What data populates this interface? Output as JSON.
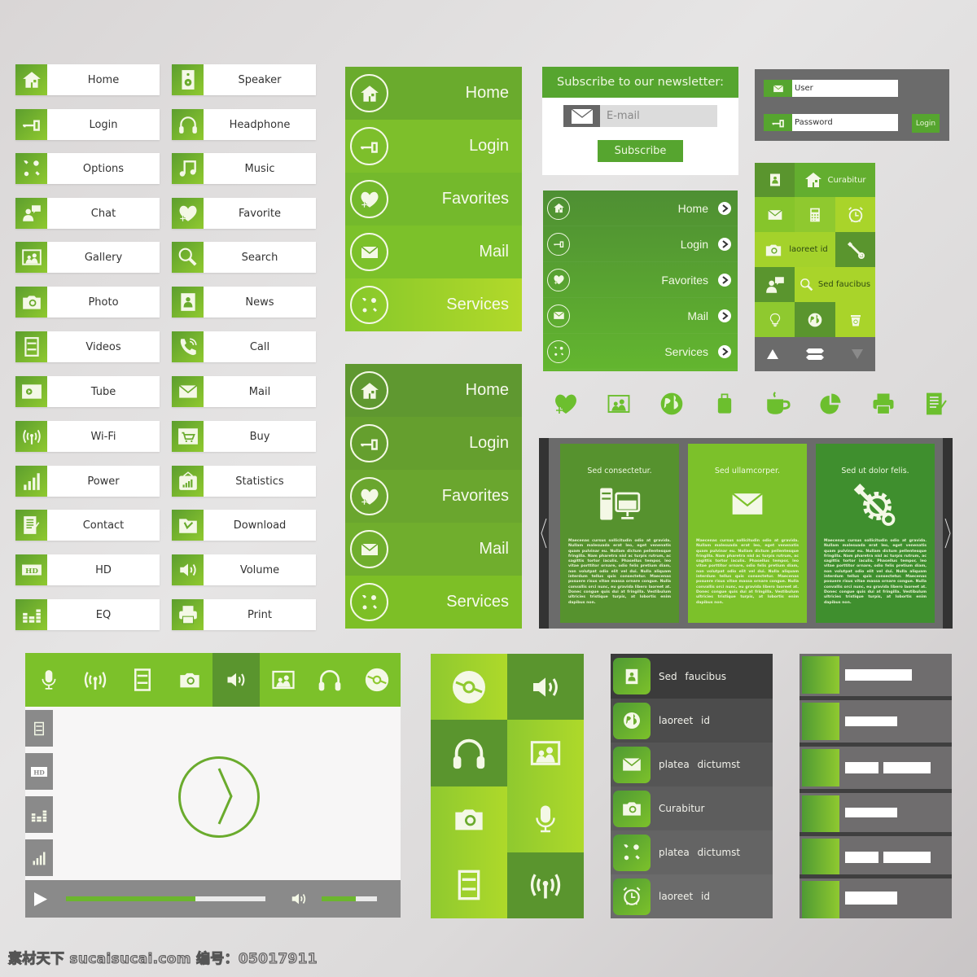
{
  "simple_buttons": {
    "left_column": [
      "Home",
      "Login",
      "Options",
      "Chat",
      "Gallery",
      "Photo",
      "Videos",
      "Tube",
      "Wi-Fi",
      "Power",
      "Contact",
      "HD",
      "EQ"
    ],
    "right_column": [
      "Speaker",
      "Headphone",
      "Music",
      "Favorite",
      "Search",
      "News",
      "Call",
      "Mail",
      "Buy",
      "Statistics",
      "Download",
      "Volume",
      "Print"
    ]
  },
  "big_menu_top": {
    "items": [
      "Home",
      "Login",
      "Favorites",
      "Mail",
      "Services"
    ]
  },
  "big_menu_bottom": {
    "items": [
      "Home",
      "Login",
      "Favorites",
      "Mail",
      "Services"
    ]
  },
  "newsletter": {
    "title": "Subscribe to our newsletter:",
    "email_placeholder": "E-mail",
    "subscribe_label": "Subscribe"
  },
  "login_form": {
    "user_placeholder": "User",
    "password_placeholder": "Password",
    "login_label": "Login"
  },
  "tile_widget": {
    "curabitur": "Curabitur",
    "laoreet": "laoreet id",
    "sed_faucibus": "Sed faucibus"
  },
  "nav_arrows": {
    "items": [
      "Home",
      "Login",
      "Favorites",
      "Mail",
      "Services"
    ]
  },
  "icon_row": [
    "heart-add",
    "gallery",
    "globe",
    "luggage",
    "coffee",
    "pie-chart",
    "printer",
    "document-edit"
  ],
  "slider": {
    "cards": [
      {
        "title": "Sed consectetur.",
        "body": "Maecenas cursus sollicitudin odio at gravida. Nullam malesuada erat leo, eget venenatis quam pulvinar eu. Nullam dictum pellentesque fringilla. Nam pharetra nisl ac turpis rutrum, ac sagittis tortor iaculis. Phasellus tempor, leo vitae porttitor ornare, odio felis pretium diam, non volutpat odio elit vel dui. Nulla aliquam interdum tellus quis consectetur. Maecenas posuere risus vitae massa ornare congue. Nulla convallis orci nunc, eu gravida libero laoreet at. Donec congue quis dui at fringilla. Vestibulum ultricies tristique turpis, at lobortis enim dapibus non."
      },
      {
        "title": "Sed ullamcorper.",
        "body": "Maecenas cursus sollicitudin odio at gravida. Nullam malesuada erat leo, eget venenatis quam pulvinar eu. Nullam dictum pellentesque fringilla. Nam pharetra nisl ac turpis rutrum, ac sagittis tortor iaculis. Phasellus tempor, leo vitae porttitor ornare, odio felis pretium diam, non volutpat odio elit vel dui. Nulla aliquam interdum tellus quis consectetur. Maecenas posuere risus vitae massa ornare congue. Nulla convallis orci nunc, eu gravida libero laoreet at. Donec congue quis dui at fringilla. Vestibulum ultricies tristique turpis, at lobortis enim dapibus non."
      },
      {
        "title": "Sed ut dolor felis.",
        "body": "Maecenas cursus sollicitudin odio at gravida. Nullam malesuada erat leo, eget venenatis quam pulvinar eu. Nullam dictum pellentesque fringilla. Nam pharetra nisl ac turpis rutrum, ac sagittis tortor iaculis. Phasellus tempor, leo vitae porttitor ornare, odio felis pretium diam, non volutpat odio elit vel dui. Nulla aliquam interdum tellus quis consectetur. Maecenas posuere risus vitae massa ornare congue. Nulla convallis orci nunc, eu gravida libero laoreet at. Donec congue quis dui at fringilla. Vestibulum ultricies tristique turpis, at lobortis enim dapibus non."
      }
    ]
  },
  "player": {
    "toolbar": [
      "microphone",
      "wifi",
      "film",
      "camera",
      "volume",
      "gallery",
      "headphone",
      "disc"
    ],
    "active_tool": "volume",
    "side_tools": [
      "film",
      "hd",
      "eq",
      "signal"
    ],
    "hd_label": "HD",
    "progress_percent": 65,
    "volume_percent": 62
  },
  "media_grid": [
    "disc",
    "volume",
    "headphone",
    "gallery",
    "camera",
    "microphone",
    "film",
    "wifi"
  ],
  "dark_list": {
    "items": [
      "Sed faucibus",
      "laoreet id",
      "platea dictumst",
      "Curabitur",
      "platea dictumst",
      "laoreet id"
    ]
  },
  "pixel_list": {
    "rows": 6
  },
  "footer": {
    "text": "素材天下 sucaisucai.com  编号：05017911"
  },
  "colors": {
    "accent": "#7cc12a",
    "dark_green": "#56a52f",
    "gray": "#6b6b6b"
  }
}
